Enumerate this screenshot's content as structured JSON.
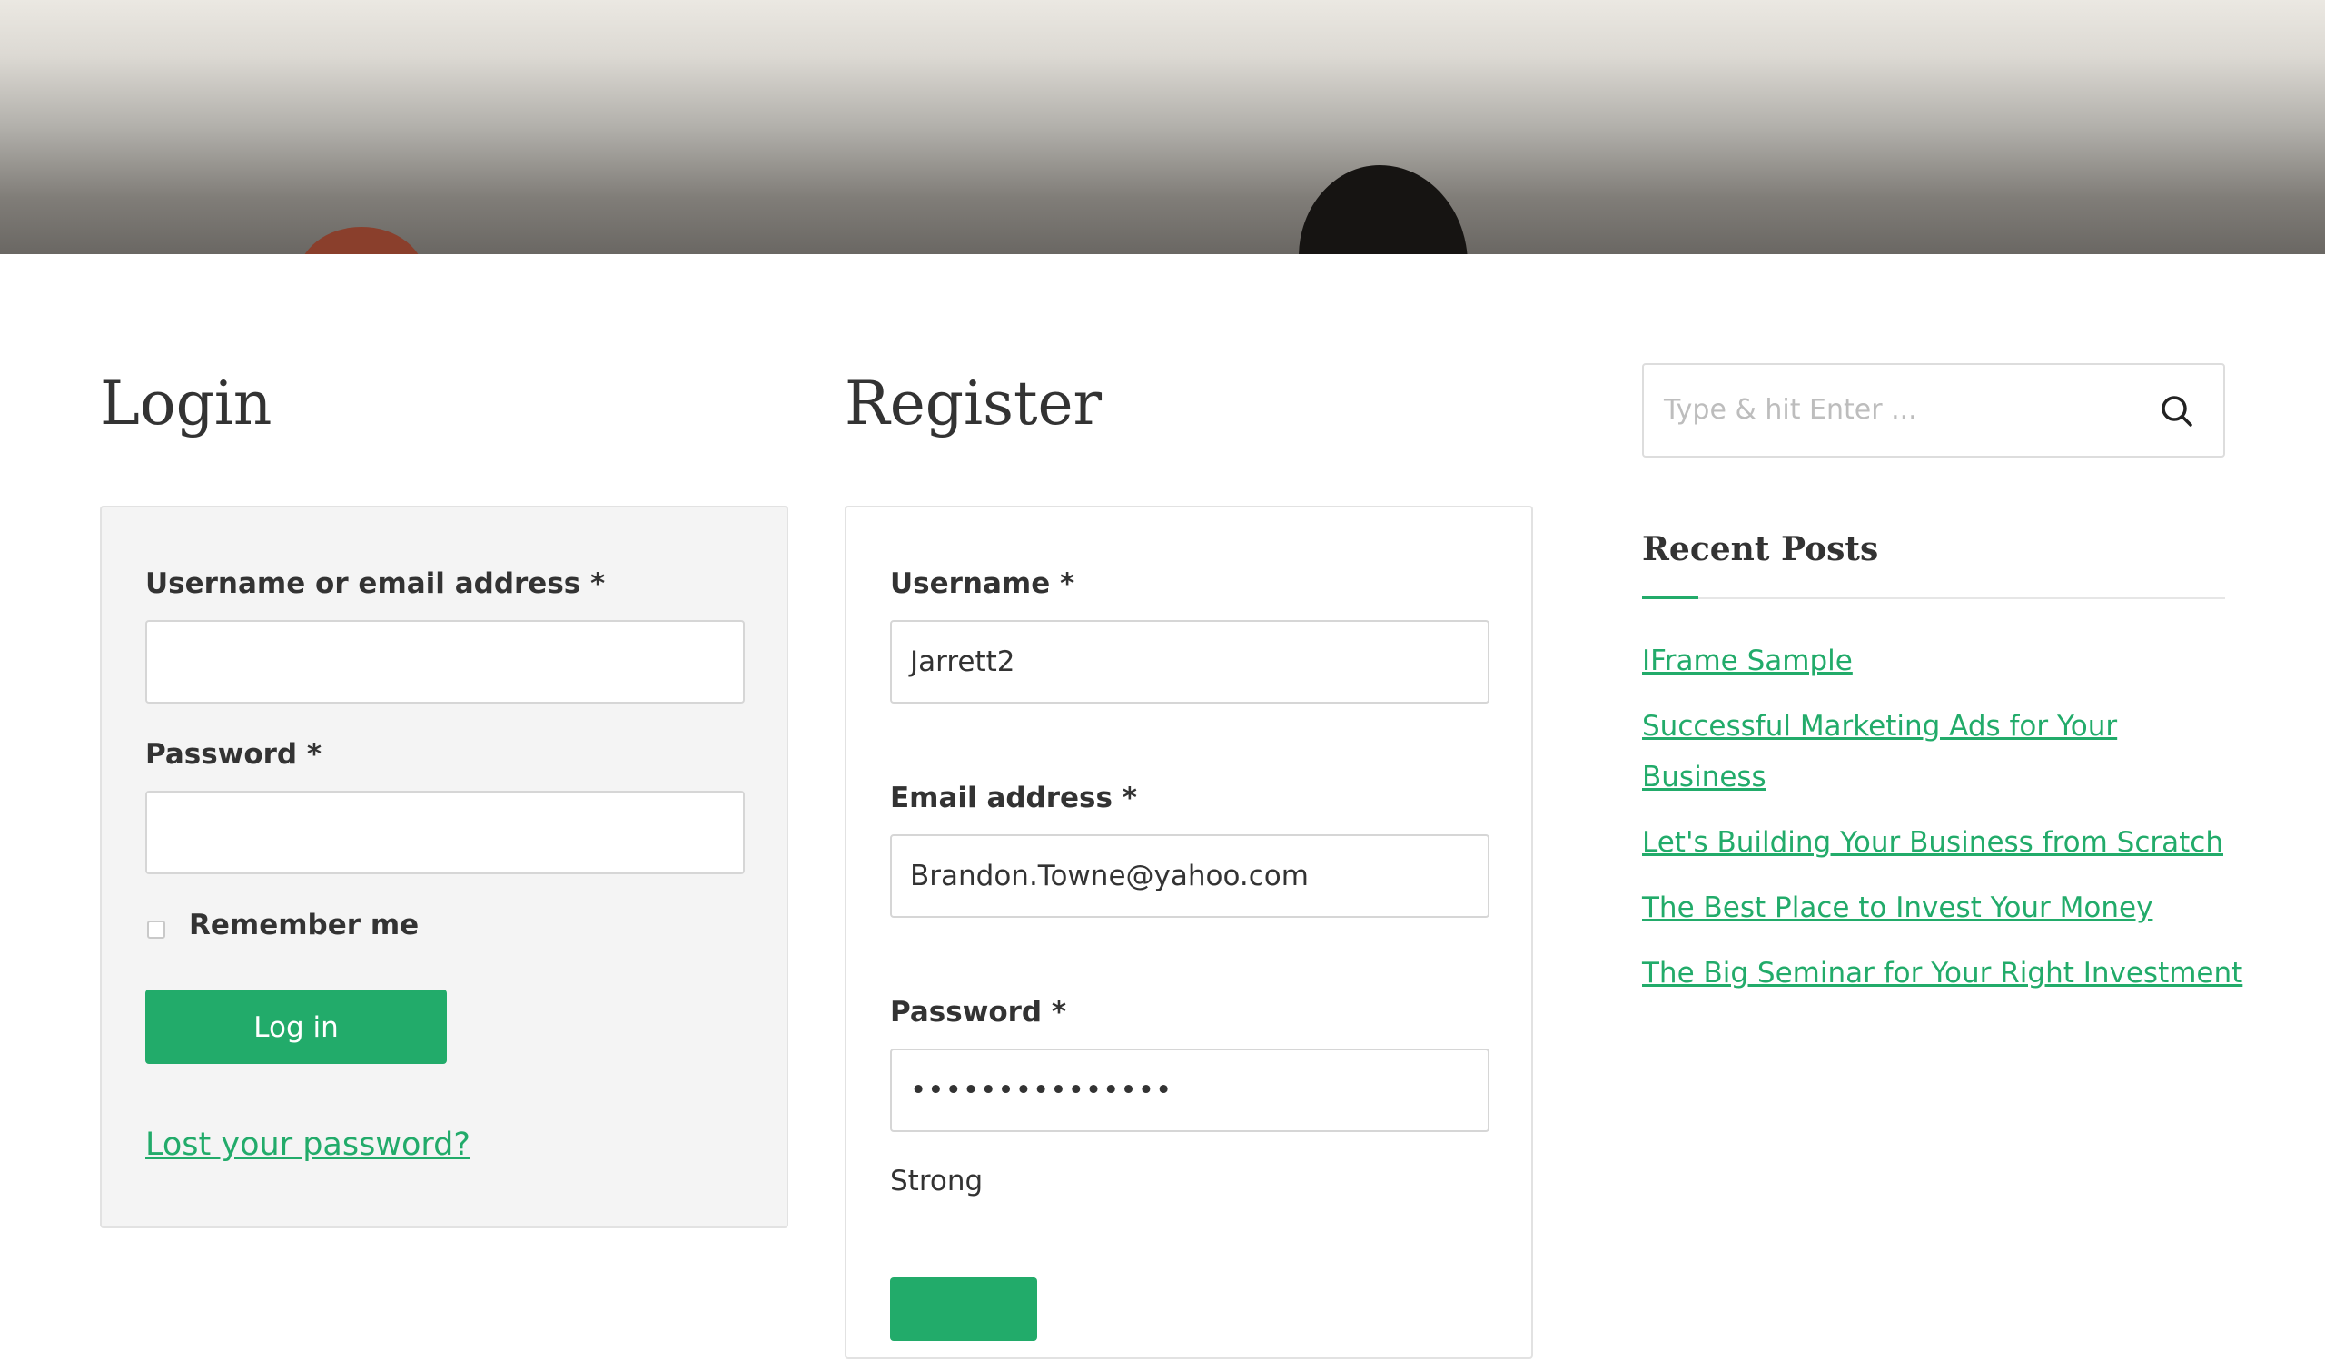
{
  "login": {
    "title": "Login",
    "username_label": "Username or email address *",
    "username_value": "",
    "password_label": "Password *",
    "password_value": "",
    "remember_label": "Remember me",
    "submit_label": "Log in",
    "lost_password_link": "Lost your password?"
  },
  "register": {
    "title": "Register",
    "username_label": "Username *",
    "username_value": "Jarrett2",
    "email_label": "Email address *",
    "email_value": "Brandon.Towne@yahoo.com",
    "password_label": "Password *",
    "password_value": "•••••••••••••••",
    "strength_text": "Strong"
  },
  "sidebar": {
    "search_placeholder": "Type & hit Enter ...",
    "recent_posts_title": "Recent Posts",
    "recent_posts": [
      {
        "title": "IFrame Sample"
      },
      {
        "title": "Successful Marketing Ads for Your Business"
      },
      {
        "title": "Let's Building Your Business from Scratch"
      },
      {
        "title": "The Best Place to Invest Your Money"
      },
      {
        "title": "The Big Seminar for Your Right Investment"
      }
    ]
  },
  "colors": {
    "accent": "#22ab6a",
    "text": "#333333",
    "panel_background": "#f4f4f4"
  },
  "icons": {
    "search": "search-icon"
  }
}
